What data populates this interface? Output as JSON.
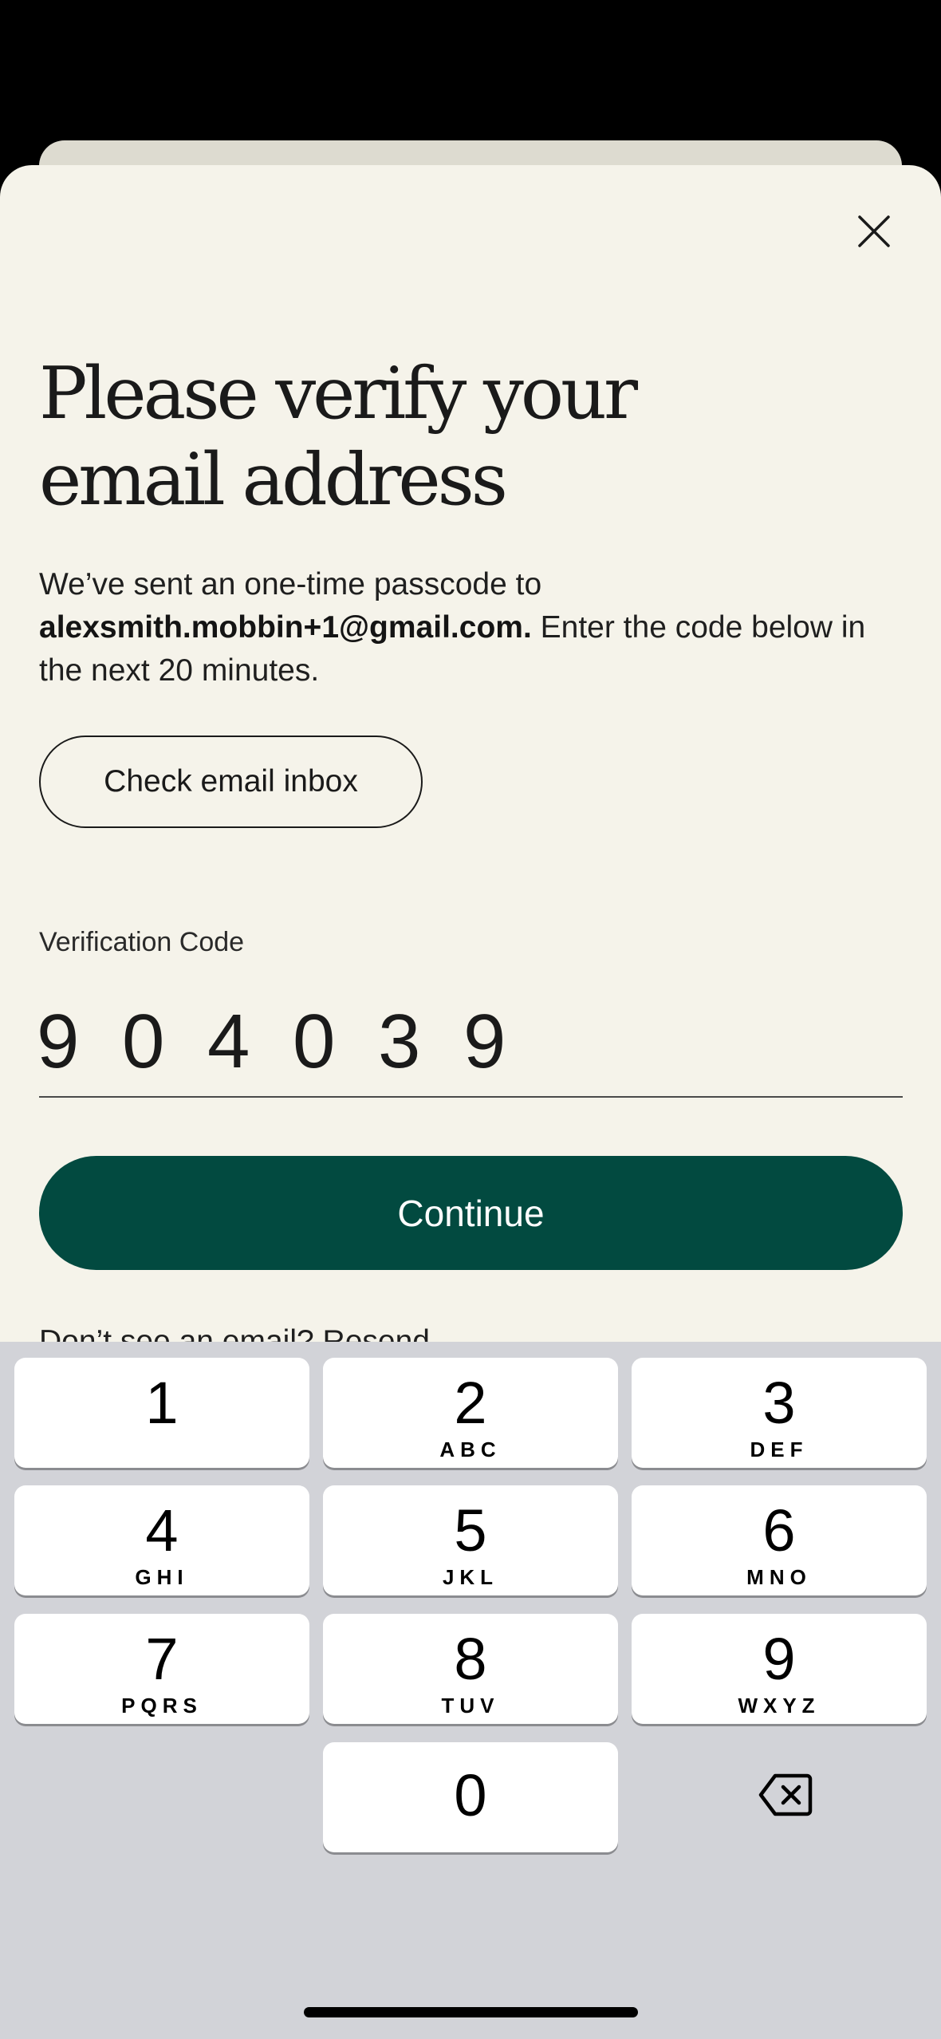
{
  "header": {
    "close_icon": "close-icon"
  },
  "title": "Please verify your email address",
  "message": {
    "prefix": "We’ve sent an one-time passcode to ",
    "email": "alexsmith.mobbin+1@gmail.com.",
    "suffix": " Enter the code below in the next 20 minutes."
  },
  "check_inbox_label": "Check email inbox",
  "verification": {
    "label": "Verification Code",
    "digits": [
      "9",
      "0",
      "4",
      "0",
      "3",
      "9"
    ]
  },
  "continue_label": "Continue",
  "resend": {
    "prefix": "Don’t see an email? ",
    "link": "Resend"
  },
  "keyboard": {
    "keys": [
      {
        "num": "1",
        "letters": ""
      },
      {
        "num": "2",
        "letters": "ABC"
      },
      {
        "num": "3",
        "letters": "DEF"
      },
      {
        "num": "4",
        "letters": "GHI"
      },
      {
        "num": "5",
        "letters": "JKL"
      },
      {
        "num": "6",
        "letters": "MNO"
      },
      {
        "num": "7",
        "letters": "PQRS"
      },
      {
        "num": "8",
        "letters": "TUV"
      },
      {
        "num": "9",
        "letters": "WXYZ"
      },
      {
        "num": "0",
        "letters": ""
      }
    ],
    "delete_icon": "delete-icon"
  },
  "colors": {
    "sheet_background": "#f5f3ea",
    "primary_button": "#024a40",
    "keyboard_background": "#d2d3d8"
  }
}
